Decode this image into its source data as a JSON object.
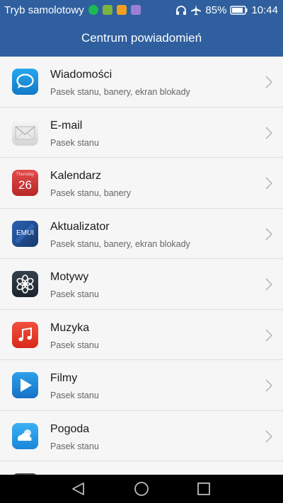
{
  "status": {
    "airplane_mode": "Tryb samolotowy",
    "battery": "85%",
    "time": "10:44"
  },
  "header": {
    "title": "Centrum powiadomień"
  },
  "apps": [
    {
      "name": "Wiadomości",
      "subtitle": "Pasek stanu, banery, ekran blokady",
      "icon": "messages-icon"
    },
    {
      "name": "E-mail",
      "subtitle": "Pasek stanu",
      "icon": "email-icon"
    },
    {
      "name": "Kalendarz",
      "subtitle": "Pasek stanu, banery",
      "icon": "calendar-icon",
      "icon_text": {
        "day": "Thursday",
        "date": "26"
      }
    },
    {
      "name": "Aktualizator",
      "subtitle": "Pasek stanu, banery, ekran blokady",
      "icon": "emui-updater-icon",
      "icon_text": {
        "label": "EMUI"
      }
    },
    {
      "name": "Motywy",
      "subtitle": "Pasek stanu",
      "icon": "themes-icon"
    },
    {
      "name": "Muzyka",
      "subtitle": "Pasek stanu",
      "icon": "music-icon"
    },
    {
      "name": "Filmy",
      "subtitle": "Pasek stanu",
      "icon": "videos-icon"
    },
    {
      "name": "Pogoda",
      "subtitle": "Pasek stanu",
      "icon": "weather-icon"
    }
  ],
  "colors": {
    "bar": "#2f5f9f",
    "background": "#f6f6f6"
  }
}
